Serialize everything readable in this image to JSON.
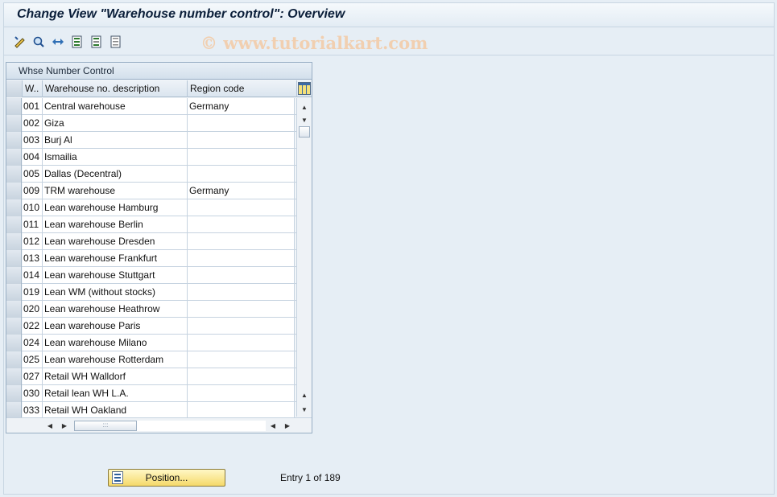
{
  "window": {
    "title": "Change View \"Warehouse number control\": Overview",
    "watermark": "© www.tutorialkart.com"
  },
  "toolbar": {
    "icons": [
      "display-change-icon",
      "find-icon",
      "other-view-icon",
      "select-all-icon",
      "select-block-icon",
      "deselect-all-icon"
    ]
  },
  "table": {
    "title": "Whse Number Control",
    "columns": [
      "W..",
      "Warehouse no. description",
      "Region code"
    ],
    "rows": [
      {
        "num": "001",
        "desc": "Central warehouse",
        "region": "Germany"
      },
      {
        "num": "002",
        "desc": "Giza",
        "region": ""
      },
      {
        "num": "003",
        "desc": "Burj Al",
        "region": ""
      },
      {
        "num": "004",
        "desc": "Ismailia",
        "region": ""
      },
      {
        "num": "005",
        "desc": "Dallas (Decentral)",
        "region": ""
      },
      {
        "num": "009",
        "desc": "TRM warehouse",
        "region": "Germany"
      },
      {
        "num": "010",
        "desc": "Lean warehouse Hamburg",
        "region": ""
      },
      {
        "num": "011",
        "desc": "Lean warehouse Berlin",
        "region": ""
      },
      {
        "num": "012",
        "desc": "Lean warehouse Dresden",
        "region": ""
      },
      {
        "num": "013",
        "desc": "Lean warehouse Frankfurt",
        "region": ""
      },
      {
        "num": "014",
        "desc": "Lean warehouse Stuttgart",
        "region": ""
      },
      {
        "num": "019",
        "desc": "Lean WM (without stocks)",
        "region": ""
      },
      {
        "num": "020",
        "desc": "Lean warehouse Heathrow",
        "region": ""
      },
      {
        "num": "022",
        "desc": "Lean warehouse Paris",
        "region": ""
      },
      {
        "num": "024",
        "desc": "Lean warehouse Milano",
        "region": ""
      },
      {
        "num": "025",
        "desc": "Lean warehouse Rotterdam",
        "region": ""
      },
      {
        "num": "027",
        "desc": "Retail WH Walldorf",
        "region": ""
      },
      {
        "num": "030",
        "desc": "Retail lean WH L.A.",
        "region": ""
      },
      {
        "num": "033",
        "desc": "Retail WH Oakland",
        "region": ""
      }
    ]
  },
  "footer": {
    "position_button": "Position...",
    "entry_text": "Entry 1 of 189"
  }
}
